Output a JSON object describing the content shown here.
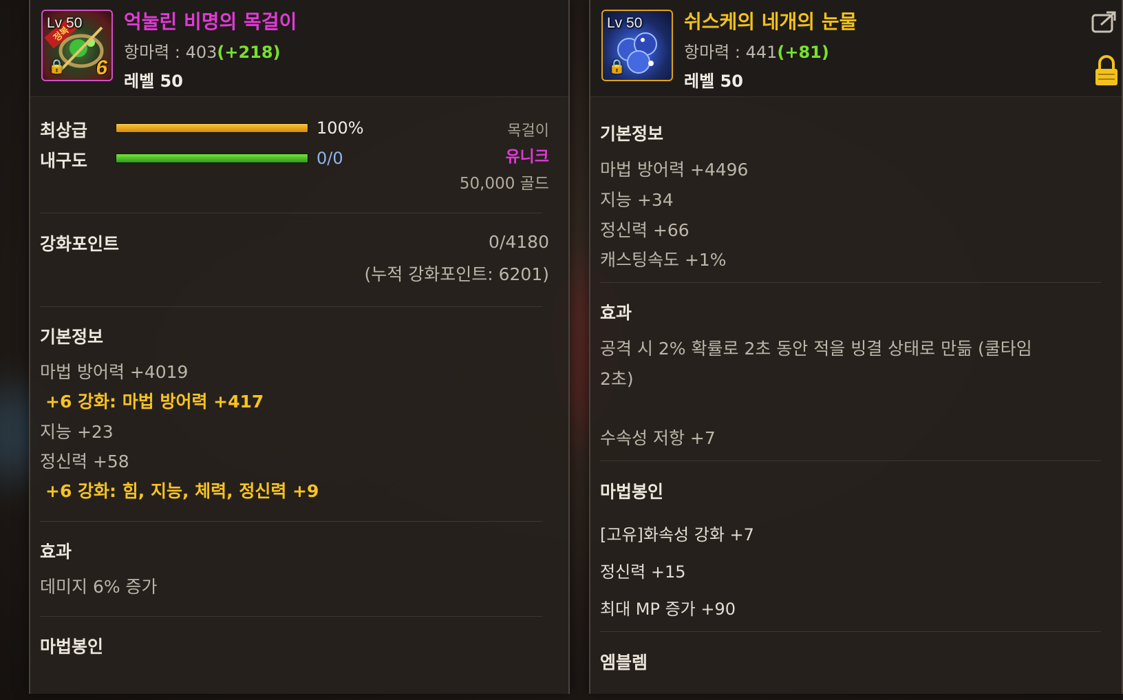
{
  "left_item": {
    "icon_level": "Lv 50",
    "icon_stamp": "정복",
    "icon_plus": "6",
    "name": "억눌린 비명의 목걸이",
    "name_color": "#e03ad6",
    "defense_label": "항마력 : 403",
    "defense_bonus": "(+218)",
    "level_text": "레벨 50",
    "grade_label": "최상급",
    "grade_percent": "100%",
    "grade_fill": 1.0,
    "durability_label": "내구도",
    "durability_value": "0/0",
    "durability_fill": 1.0,
    "slot": "목걸이",
    "rarity": "유니크",
    "price": "50,000 골드",
    "upgrade_label": "강화포인트",
    "upgrade_value": "0/4180",
    "upgrade_total": "(누적 강화포인트: 6201)",
    "basic_title": "기본정보",
    "basic_stats": [
      "마법 방어력 +4019",
      "+6 강화: 마법 방어력 +417",
      "지능 +23",
      "정신력 +58",
      "+6 강화: 힘, 지능, 체력, 정신력 +9"
    ],
    "effect_title": "효과",
    "effect_text": "데미지 6% 증가",
    "seal_title": "마법봉인"
  },
  "right_item": {
    "icon_level": "Lv 50",
    "name": "쉬스케의 네개의 눈물",
    "name_color": "#f2c21c",
    "defense_label": "항마력 : 441",
    "defense_bonus": "(+81)",
    "level_text": "레벨 50",
    "basic_title": "기본정보",
    "basic_stats": [
      "마법 방어력 +4496",
      "지능 +34",
      "정신력 +66",
      "캐스팅속도 +1%"
    ],
    "effect_title": "효과",
    "effect_line1": "공격 시 2% 확률로 2초 동안 적을 빙결 상태로 만듦 (쿨타임",
    "effect_line2": "2초)",
    "resist_text": "수속성 저항 +7",
    "seal_title": "마법봉인",
    "seal_stats": [
      "[고유]화속성 강화 +7",
      "정신력 +15",
      "최대 MP 증가 +90"
    ],
    "emblem_title": "엠블렘"
  },
  "colors": {
    "accent_gold": "#f7c323",
    "bonus_green": "#78e030",
    "unique_pink": "#e03ad6",
    "durability_blue": "#8fb4f0"
  },
  "icons": [
    "padlock-icon",
    "share-icon"
  ]
}
